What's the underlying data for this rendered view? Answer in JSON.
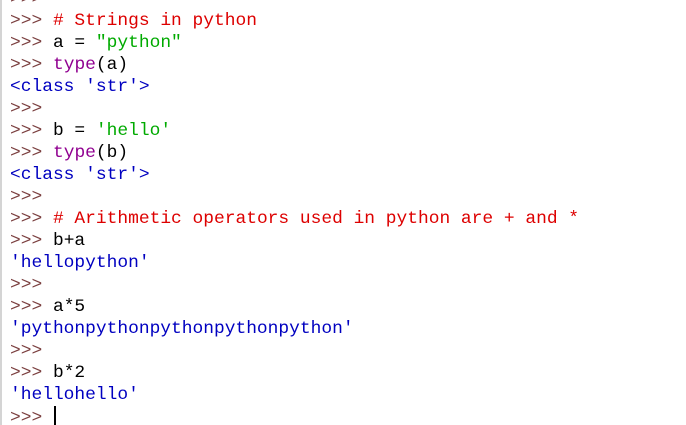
{
  "prompt": ">>>",
  "prompt_color": "#7b3f3f",
  "colors": {
    "comment": "#dd0000",
    "builtin": "#900090",
    "string": "#00aa00",
    "output": "#0000c0",
    "code": "#000000"
  },
  "lines": [
    {
      "type": "prompt",
      "segments": []
    },
    {
      "type": "prompt",
      "segments": [
        {
          "text": " # Strings in python",
          "style": "comment"
        }
      ]
    },
    {
      "type": "prompt",
      "segments": [
        {
          "text": " a = ",
          "style": "code"
        },
        {
          "text": "\"python\"",
          "style": "string"
        }
      ]
    },
    {
      "type": "prompt",
      "segments": [
        {
          "text": " ",
          "style": "code"
        },
        {
          "text": "type",
          "style": "builtin"
        },
        {
          "text": "(a)",
          "style": "code"
        }
      ]
    },
    {
      "type": "output",
      "segments": [
        {
          "text": "<class 'str'>",
          "style": "output"
        }
      ]
    },
    {
      "type": "prompt",
      "segments": []
    },
    {
      "type": "prompt",
      "segments": [
        {
          "text": " b = ",
          "style": "code"
        },
        {
          "text": "'hello'",
          "style": "string"
        }
      ]
    },
    {
      "type": "prompt",
      "segments": [
        {
          "text": " ",
          "style": "code"
        },
        {
          "text": "type",
          "style": "builtin"
        },
        {
          "text": "(b)",
          "style": "code"
        }
      ]
    },
    {
      "type": "output",
      "segments": [
        {
          "text": "<class 'str'>",
          "style": "output"
        }
      ]
    },
    {
      "type": "prompt",
      "segments": []
    },
    {
      "type": "prompt",
      "segments": [
        {
          "text": " # Arithmetic operators used in python are + and *",
          "style": "comment"
        }
      ]
    },
    {
      "type": "prompt",
      "segments": [
        {
          "text": " b+a",
          "style": "code"
        }
      ]
    },
    {
      "type": "output",
      "segments": [
        {
          "text": "'hellopython'",
          "style": "output"
        }
      ]
    },
    {
      "type": "prompt",
      "segments": []
    },
    {
      "type": "prompt",
      "segments": [
        {
          "text": " a*5",
          "style": "code"
        }
      ]
    },
    {
      "type": "output",
      "segments": [
        {
          "text": "'pythonpythonpythonpythonpython'",
          "style": "output"
        }
      ]
    },
    {
      "type": "prompt",
      "segments": []
    },
    {
      "type": "prompt",
      "segments": [
        {
          "text": " b*2",
          "style": "code"
        }
      ]
    },
    {
      "type": "output",
      "segments": [
        {
          "text": "'hellohello'",
          "style": "output"
        }
      ]
    },
    {
      "type": "prompt",
      "segments": [
        {
          "text": " ",
          "style": "code"
        }
      ],
      "cursor": true
    }
  ]
}
